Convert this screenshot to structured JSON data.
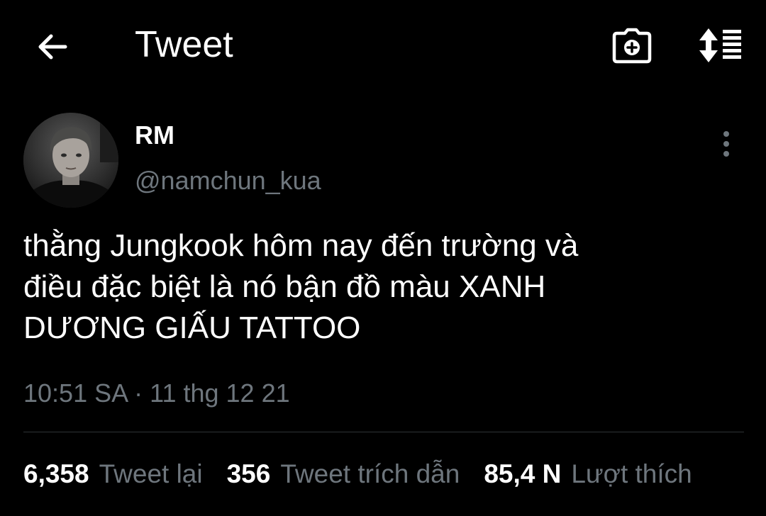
{
  "header": {
    "title": "Tweet",
    "back_icon": "arrow-left-icon",
    "camera_icon": "camera-plus-icon",
    "sort_icon": "sort-list-icon"
  },
  "author": {
    "display_name": "RM",
    "handle": "@namchun_kua",
    "avatar_icon": "avatar-photo"
  },
  "tweet": {
    "lines": [
      "thằng Jungkook hôm nay đến trường và",
      "điều đặc biệt là nó bận đồ màu XANH",
      "DƯƠNG GIẤU TATTOO"
    ],
    "timestamp": "10:51 SA · 11 thg 12 21"
  },
  "stats": [
    {
      "value": "6,358",
      "label": "Tweet lại"
    },
    {
      "value": "356",
      "label": "Tweet trích dẫn"
    },
    {
      "value": "85,4 N",
      "label": "Lượt thích"
    }
  ],
  "colors": {
    "background": "#000000",
    "primary_text": "#ffffff",
    "secondary_text": "#6e767d",
    "divider": "#2f3336"
  }
}
